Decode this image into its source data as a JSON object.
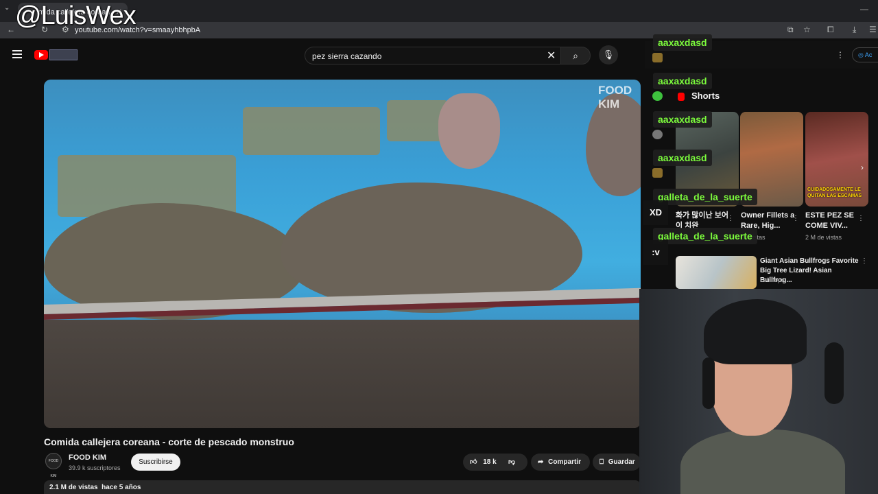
{
  "browser": {
    "tab_title": "mida callejera corean",
    "url": "youtube.com/watch?v=smaayhbhpbA",
    "icons": [
      "back-icon",
      "reload-icon",
      "site-info-icon",
      "cast-icon",
      "star-icon",
      "extensions-icon",
      "download-icon"
    ]
  },
  "overlay": {
    "handle": "@LuisWex"
  },
  "masthead": {
    "search_query": "pez sierra cazando",
    "icons": [
      "menu-icon",
      "youtube-logo",
      "clear-icon",
      "search-icon",
      "mic-icon"
    ]
  },
  "video": {
    "watermark": "FOOD KIM",
    "title": "Comida callejera coreana - corte de pescado monstruo",
    "channel_name": "FOOD KIM",
    "channel_avatar_text": "FOOD KIM",
    "subscribers": "39.9 k suscriptores",
    "subscribe_label": "Suscribirse",
    "likes": "18 k",
    "share_label": "Compartir",
    "save_label": "Guardar",
    "views": "2.1 M de vistas",
    "age": "hace 5 años"
  },
  "sidebar": {
    "signin_label": "Ac",
    "shorts_heading": "Shorts",
    "shorts": [
      {
        "title": "화가 많이난 보어이 치완",
        "views": ""
      },
      {
        "title": "Owner Fillets a Rare, Hig...",
        "views": "de vistas"
      },
      {
        "title": "ESTE PEZ SE COME VIV...",
        "views": "2 M de vistas",
        "thumb_text": "CUIDADOSAMENTE LE QUITAN LAS ESCAMAS"
      }
    ],
    "recommended": {
      "title": "Giant Asian Bullfrogs Favorite Big Tree Lizard! Asian Bullfrog...",
      "channel": "Lolilhops"
    }
  },
  "chat": [
    {
      "user": "aaxaxdasd",
      "badge_color": "#8a6d2a",
      "message": ""
    },
    {
      "user": "aaxaxdasd",
      "badge_color": "#3ec13e",
      "message": ""
    },
    {
      "user": "aaxaxdasd",
      "badge_color": "#666666",
      "message": ""
    },
    {
      "user": "aaxaxdasd",
      "badge_color": "#8a6d2a",
      "message": ""
    },
    {
      "user": "galleta_de_la_suerte",
      "badge_color": "",
      "message": "XD"
    },
    {
      "user": "galleta_de_la_suerte",
      "badge_color": "",
      "message": ":v"
    }
  ],
  "colors": {
    "chat_name": "#7cfc3c",
    "yt_red": "#ff0000",
    "link_blue": "#3ea6ff"
  }
}
